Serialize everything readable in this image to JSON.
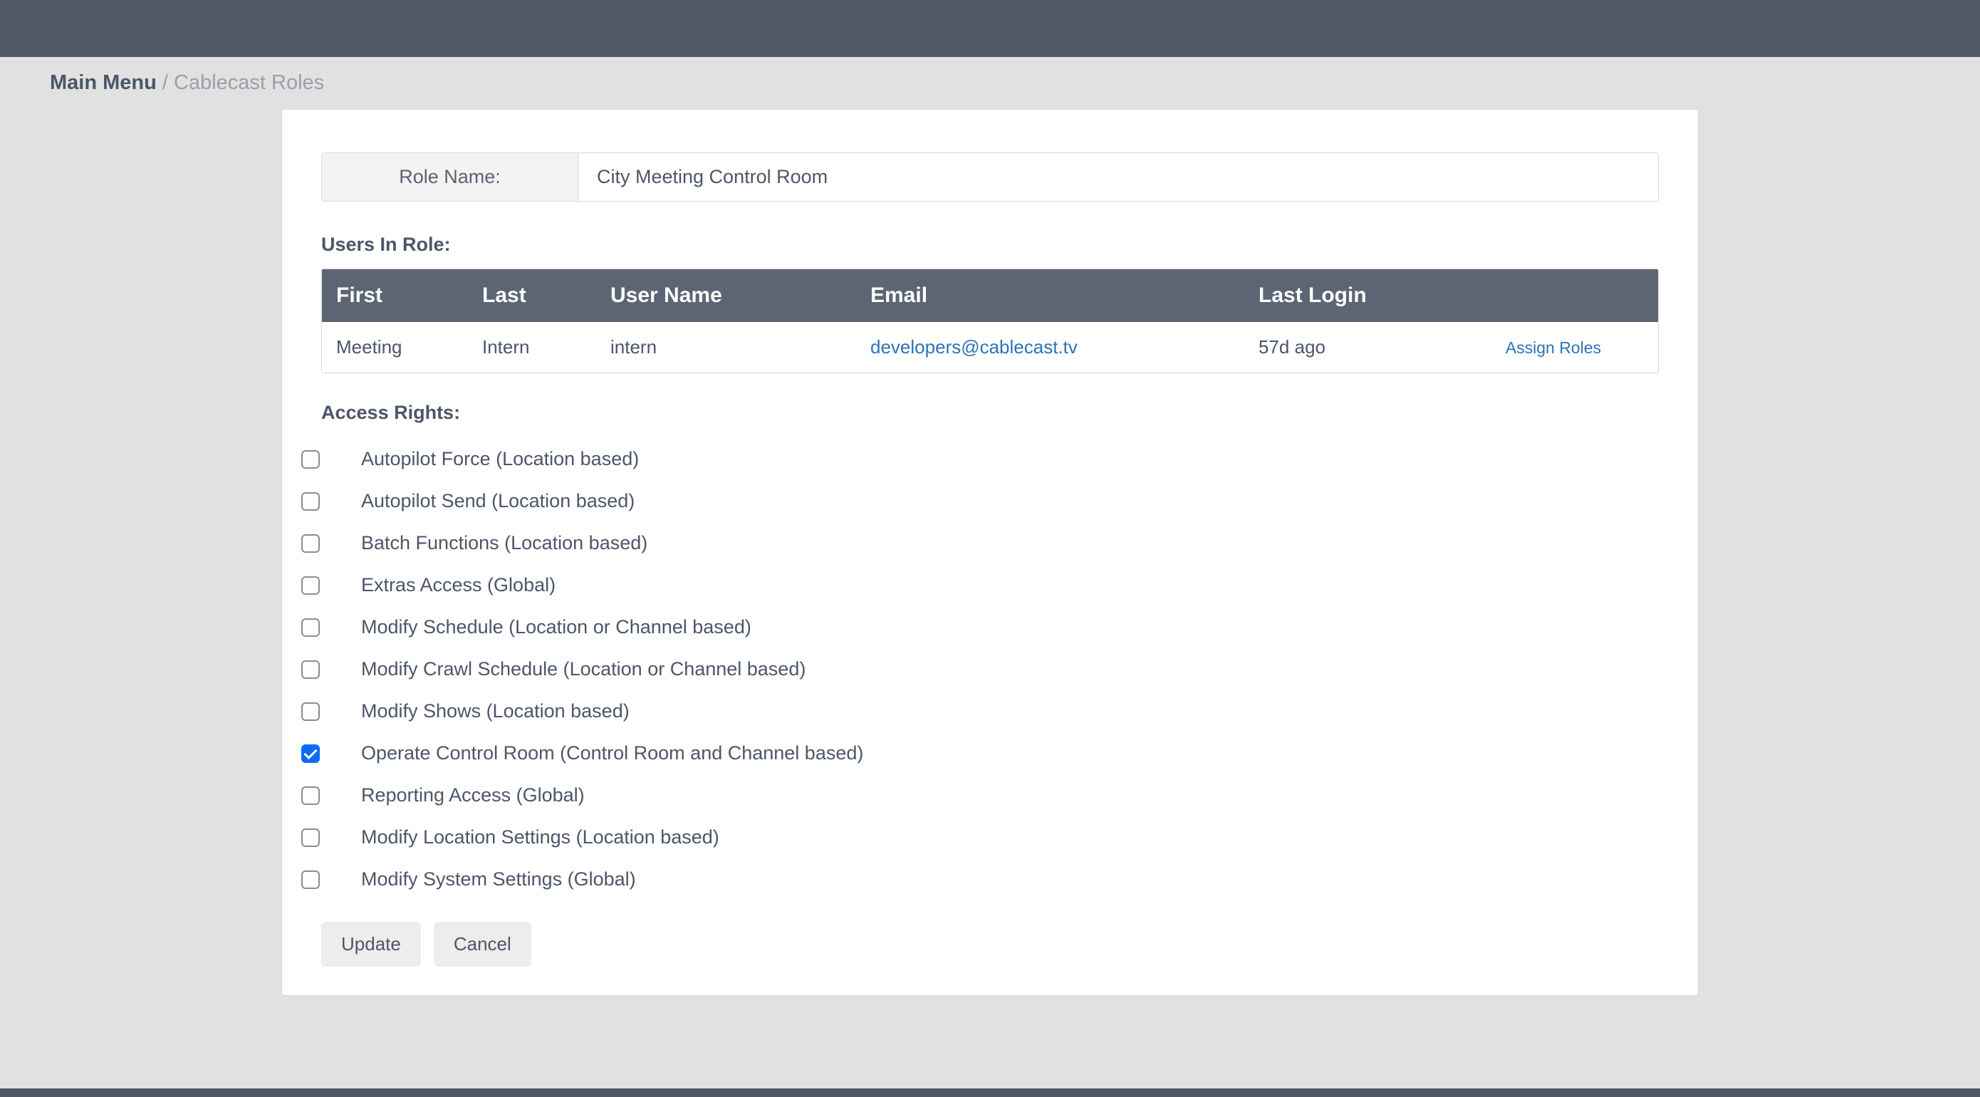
{
  "breadcrumb": {
    "root": "Main Menu",
    "separator": " / ",
    "current": "Cablecast Roles"
  },
  "role_name": {
    "label": "Role Name:",
    "value": "City Meeting Control Room"
  },
  "users_in_role": {
    "heading": "Users In Role:",
    "columns": {
      "first": "First",
      "last": "Last",
      "username": "User Name",
      "email": "Email",
      "lastlogin": "Last Login"
    },
    "rows": [
      {
        "first": "Meeting",
        "last": "Intern",
        "username": "intern",
        "email": "developers@cablecast.tv",
        "lastlogin": "57d ago",
        "action": "Assign Roles"
      }
    ]
  },
  "access_rights": {
    "heading": "Access Rights:",
    "items": [
      {
        "label": "Autopilot Force (Location based)",
        "checked": false
      },
      {
        "label": "Autopilot Send (Location based)",
        "checked": false
      },
      {
        "label": "Batch Functions (Location based)",
        "checked": false
      },
      {
        "label": "Extras Access (Global)",
        "checked": false
      },
      {
        "label": "Modify Schedule (Location or Channel based)",
        "checked": false
      },
      {
        "label": "Modify Crawl Schedule (Location or Channel based)",
        "checked": false
      },
      {
        "label": "Modify Shows (Location based)",
        "checked": false
      },
      {
        "label": "Operate Control Room (Control Room and Channel based)",
        "checked": true
      },
      {
        "label": "Reporting Access (Global)",
        "checked": false
      },
      {
        "label": "Modify Location Settings (Location based)",
        "checked": false
      },
      {
        "label": "Modify System Settings (Global)",
        "checked": false
      }
    ]
  },
  "buttons": {
    "update": "Update",
    "cancel": "Cancel"
  }
}
